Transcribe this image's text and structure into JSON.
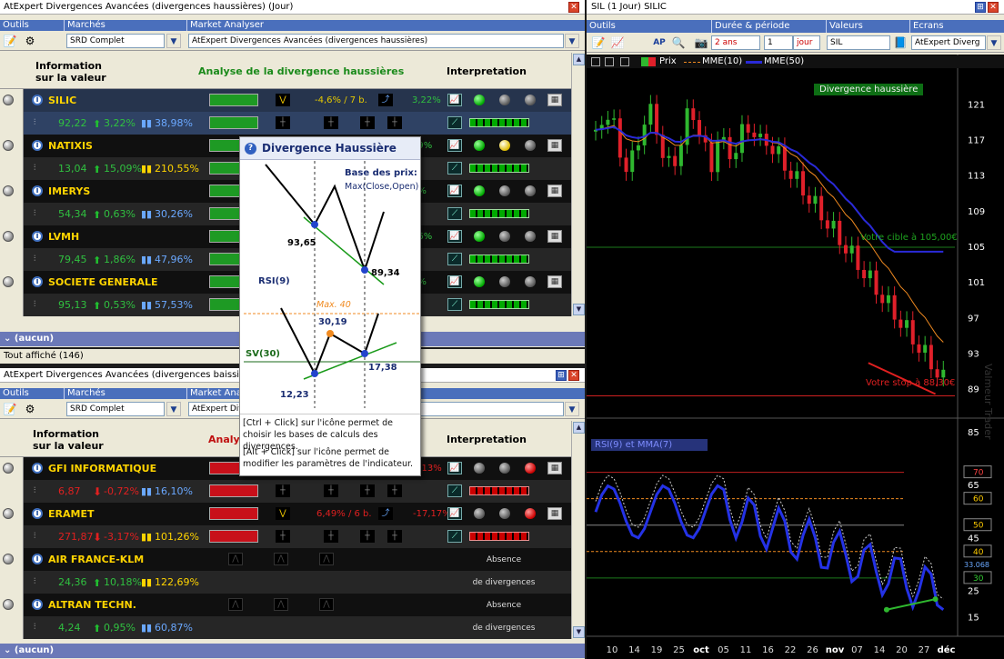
{
  "top_pane": {
    "title": "AtExpert Divergences Avancées (divergences haussières) (Jour)",
    "hdr": {
      "outils": "Outils",
      "marches": "Marchés",
      "analyser": "Market Analyser"
    },
    "market": "SRD Complet",
    "analyser": "AtExpert Divergences Avancées (divergences haussières)",
    "col_info": "Information\nsur la valeur",
    "col_analysis": "Analyse de la divergence haussières",
    "col_interp": "Interpretation",
    "rows": [
      {
        "name": "SILIC",
        "price": "92,22",
        "change": "3,22%",
        "vol": "38,98%",
        "sig_txt": "-4,6% / 7 b.",
        "sig_pct": "3,22%"
      },
      {
        "name": "NATIXIS",
        "price": "13,04",
        "change": "15,09%",
        "vol": "210,55%",
        "sig_pct": "09%"
      },
      {
        "name": "IMERYS",
        "price": "54,34",
        "change": "0,63%",
        "vol": "30,26%",
        "sig_pct": "3%"
      },
      {
        "name": "LVMH",
        "price": "79,45",
        "change": "1,86%",
        "vol": "47,96%",
        "sig_pct": "36%"
      },
      {
        "name": "SOCIETE GENERALE",
        "price": "95,13",
        "change": "0,53%",
        "vol": "57,53%",
        "sig_pct": "3%"
      }
    ],
    "group": "(aucun)",
    "status": "Tout affiché (146)"
  },
  "bottom_pane": {
    "title": "AtExpert Divergences Avancées (divergences baissièr",
    "hdr": {
      "outils": "Outils",
      "marches": "Marchés",
      "analyser": "Market Analyse"
    },
    "market": "SRD Complet",
    "analyser": "AtExpert Div",
    "col_info": "Information\nsur la valeur",
    "col_analysis": "Analys",
    "col_interp": "Interpretation",
    "rows": [
      {
        "name": "GFI INFORMATIQUE",
        "price": "6,87",
        "change": "-0,72%",
        "vol": "16,10%",
        "sig_pct": "7,13%"
      },
      {
        "name": "ERAMET",
        "price": "271,87",
        "change": "-3,17%",
        "vol": "101,26%",
        "sig_txt": "6,49% / 6 b.",
        "sig_pct": "-17,17%"
      },
      {
        "name": "AIR FRANCE-KLM",
        "price": "24,36",
        "change": "10,18%",
        "vol": "122,69%",
        "absence1": "Absence",
        "absence2": "de divergences"
      },
      {
        "name": "ALTRAN TECHN.",
        "price": "4,24",
        "change": "0,95%",
        "vol": "60,87%",
        "absence1": "Absence",
        "absence2": "de divergences"
      }
    ],
    "group": "(aucun)"
  },
  "popup": {
    "title": "Divergence Haussière",
    "base_label": "Base des prix:",
    "base_value": "Max(Close,Open)",
    "p1": "93,65",
    "p2": "89,34",
    "rsi": "RSI(9)",
    "max": "Max. 40",
    "r_top": "30,19",
    "sv": "SV(30)",
    "r1": "12,23",
    "r2": "17,38",
    "help1": "[Ctrl + Click] sur l'icône permet de choisir les bases de calculs des divergences.",
    "help2": "[Alt + Click] sur l'icône permet de modifier les paramètres de l'indicateur."
  },
  "chart_pane": {
    "title": "SIL (1 Jour) SILIC",
    "hdr": {
      "outils": "Outils",
      "duree": "Durée & période",
      "valeurs": "Valeurs",
      "ecrans": "Ecrans"
    },
    "period": "2 ans",
    "count": "1",
    "unit": "jour",
    "symbol": "SIL",
    "screen": "AtExpert Diverg",
    "legend": {
      "prix": "Prix",
      "mme10": "MME(10)",
      "mme50": "MME(50)"
    },
    "div_label": "Divergence haussière",
    "target_label": "Votre cible à 105,00€",
    "stop_label": "Votre stop à 88,30€",
    "rsi_label": "RSI(9) et MMA(7)",
    "watermark": "Valmeur Trader",
    "price_ticks": [
      "121",
      "117",
      "113",
      "109",
      "105",
      "101",
      "97",
      "93",
      "89"
    ],
    "rsi_ticks": [
      "85",
      "65",
      "45",
      "25",
      "15"
    ],
    "rsi_boxes": [
      "70",
      "60",
      "50",
      "40",
      "30"
    ],
    "rsi_extra": "33.068",
    "x_ticks": [
      "10",
      "14",
      "19",
      "25",
      "oct",
      "05",
      "11",
      "16",
      "22",
      "26",
      "nov",
      "07",
      "14",
      "20",
      "27",
      "déc"
    ],
    "colors": {
      "up": "#2fb82f",
      "down": "#e0202a",
      "mme10": "#f08a20",
      "mme50": "#2a2ad8",
      "rsi": "#2432e6"
    }
  },
  "chart_data": {
    "type": "line",
    "title": "SIL (1 Jour) SILIC",
    "series": [
      {
        "name": "Prix"
      },
      {
        "name": "MME(10)"
      },
      {
        "name": "MME(50)"
      }
    ],
    "hlines": [
      {
        "label": "Votre cible à 105,00€",
        "value": 105.0
      },
      {
        "label": "Votre stop à 88,30€",
        "value": 88.3
      }
    ],
    "price_range": [
      86,
      124
    ],
    "rsi_levels": [
      70,
      60,
      50,
      40,
      30
    ]
  }
}
